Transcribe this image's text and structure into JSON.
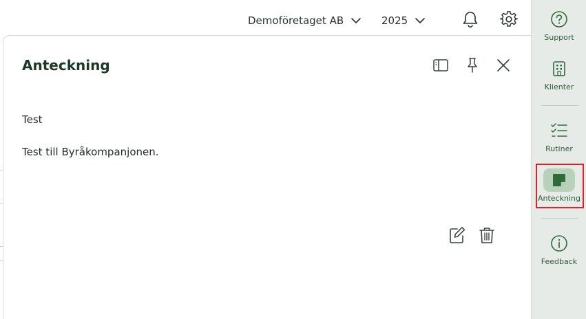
{
  "header": {
    "company_label": "Demoföretaget AB",
    "year_label": "2025",
    "icons": [
      "bell-icon",
      "gear-icon",
      "chevron-down-icon"
    ]
  },
  "panel": {
    "title": "Anteckning",
    "icons": [
      "sidebar-toggle-icon",
      "pin-icon",
      "close-icon"
    ]
  },
  "note": {
    "title": "Test",
    "body": "Test till Byråkompanjonen.",
    "icons": [
      "edit-icon",
      "trash-icon"
    ]
  },
  "sidebar": {
    "items": [
      {
        "label": "Support",
        "icon": "help-circle-icon"
      },
      {
        "label": "Klienter",
        "icon": "building-icon"
      },
      {
        "label": "Rutiner",
        "icon": "checklist-icon"
      },
      {
        "label": "Anteckning",
        "icon": "note-icon",
        "active": true
      },
      {
        "label": "Feedback",
        "icon": "info-circle-icon"
      }
    ]
  },
  "colors": {
    "accent_green": "#2f6a3b",
    "active_pill": "#b8d2b9",
    "highlight_red": "#e0202a",
    "sidebar_bg": "#e7ebe8"
  }
}
